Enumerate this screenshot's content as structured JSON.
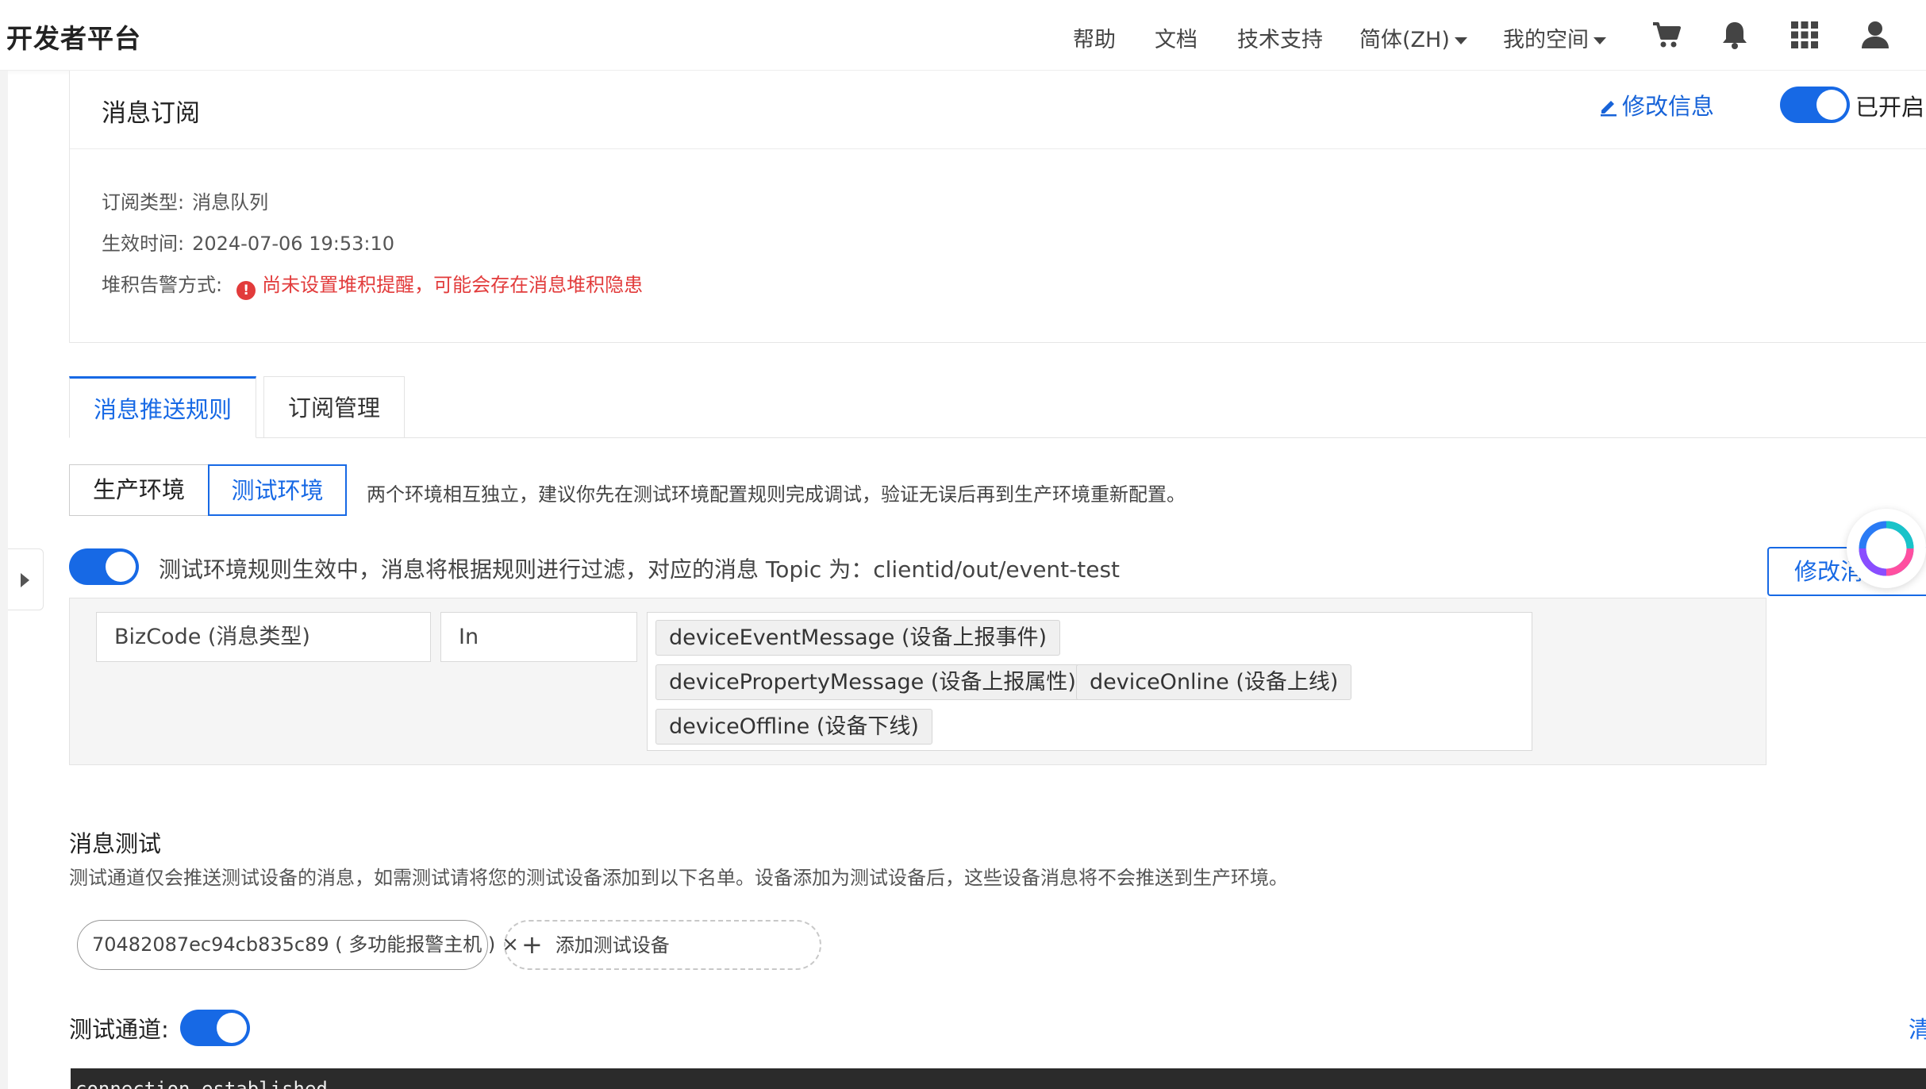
{
  "header": {
    "brand": "开发者平台",
    "nav": {
      "help": "帮助",
      "docs": "文档",
      "support": "技术支持",
      "language": "简体(ZH)",
      "workspace": "我的空间"
    },
    "icons": [
      "cart-icon",
      "bell-icon",
      "apps-grid-icon",
      "user-icon"
    ]
  },
  "subscription": {
    "title": "消息订阅",
    "edit_label": "修改信息",
    "status_label": "已开启",
    "enabled": true,
    "type_label": "订阅类型:",
    "type_value": "消息队列",
    "time_label": "生效时间:",
    "time_value": "2024-07-06 19:53:10",
    "alert_label": "堆积告警方式:",
    "alert_icon": "!",
    "alert_value": "尚未设置堆积提醒，可能会存在消息堆积隐患"
  },
  "tabs": [
    {
      "label": "消息推送规则",
      "active": true
    },
    {
      "label": "订阅管理",
      "active": false
    }
  ],
  "env": {
    "prod_label": "生产环境",
    "test_label": "测试环境",
    "selected": "测试环境",
    "tip": "两个环境相互独立，建议你先在测试环境配置规则完成调试，验证无误后再到生产环境重新配置。"
  },
  "rule": {
    "enabled": true,
    "description": "测试环境规则生效中，消息将根据规则进行过滤，对应的消息 Topic 为：clientid/out/event-test",
    "edit_button": "修改消",
    "field": "BizCode (消息类型)",
    "operator": "In",
    "values": [
      "deviceEventMessage (设备上报事件)",
      "devicePropertyMessage (设备上报属性)",
      "deviceOnline (设备上线)",
      "deviceOffline (设备下线)"
    ]
  },
  "message_test": {
    "title": "消息测试",
    "description": "测试通道仅会推送测试设备的消息，如需测试请将您的测试设备添加到以下名单。设备添加为测试设备后，这些设备消息将不会推送到生产环境。",
    "device_tag": "70482087ec94cb835c89 ( 多功能报警主机 )",
    "device_remove": "×",
    "add_device_icon": "+",
    "add_device": "添加测试设备",
    "channel_label": "测试通道:",
    "channel_enabled": true,
    "clear_label": "清",
    "console_text": "connection established"
  },
  "colors": {
    "primary": "#1769e5",
    "error": "#e23b3b",
    "console_bg": "#2b2b2b"
  }
}
